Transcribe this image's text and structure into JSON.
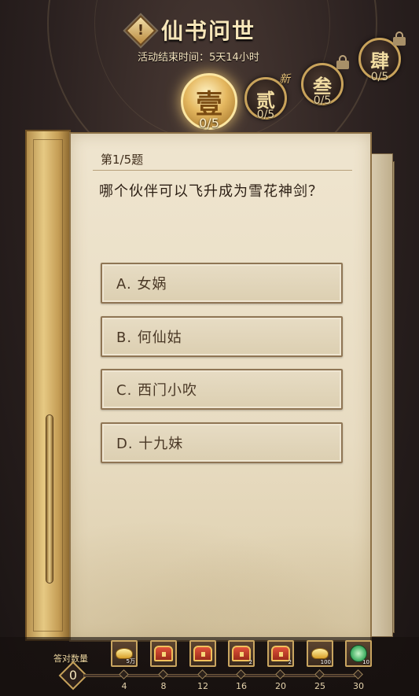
{
  "header": {
    "info_icon": "!",
    "title": "仙书问世",
    "countdown": "活动结束时间：5天14小时"
  },
  "chapters": [
    {
      "label": "壹",
      "progress": "0/5",
      "state": "active"
    },
    {
      "label": "贰",
      "progress": "0/5",
      "state": "new",
      "badge": "新"
    },
    {
      "label": "叁",
      "progress": "0/5",
      "state": "locked"
    },
    {
      "label": "肆",
      "progress": "0/5",
      "state": "locked"
    }
  ],
  "quiz": {
    "index": "第1/5题",
    "question": "哪个伙伴可以飞升成为雪花神剑？",
    "options": [
      "A. 女娲",
      "B. 何仙姑",
      "C. 西门小吹",
      "D. 十九妹"
    ]
  },
  "progress": {
    "label": "答对数量",
    "value": "0",
    "ticks": [
      "4",
      "8",
      "12",
      "16",
      "20",
      "25",
      "30"
    ],
    "rewards": [
      {
        "icon": "gold-ingot-icon",
        "qty": "5万"
      },
      {
        "icon": "treasure-chest-icon",
        "qty": ""
      },
      {
        "icon": "treasure-chest-icon",
        "qty": ""
      },
      {
        "icon": "treasure-chest-icon",
        "qty": "2"
      },
      {
        "icon": "treasure-chest-icon",
        "qty": "2"
      },
      {
        "icon": "gold-ingot-icon",
        "qty": "100"
      },
      {
        "icon": "jade-icon",
        "qty": "10"
      }
    ]
  },
  "colors": {
    "gold": "#c9a35b",
    "paper": "#efe5cf",
    "text_dark": "#2c1f14"
  }
}
